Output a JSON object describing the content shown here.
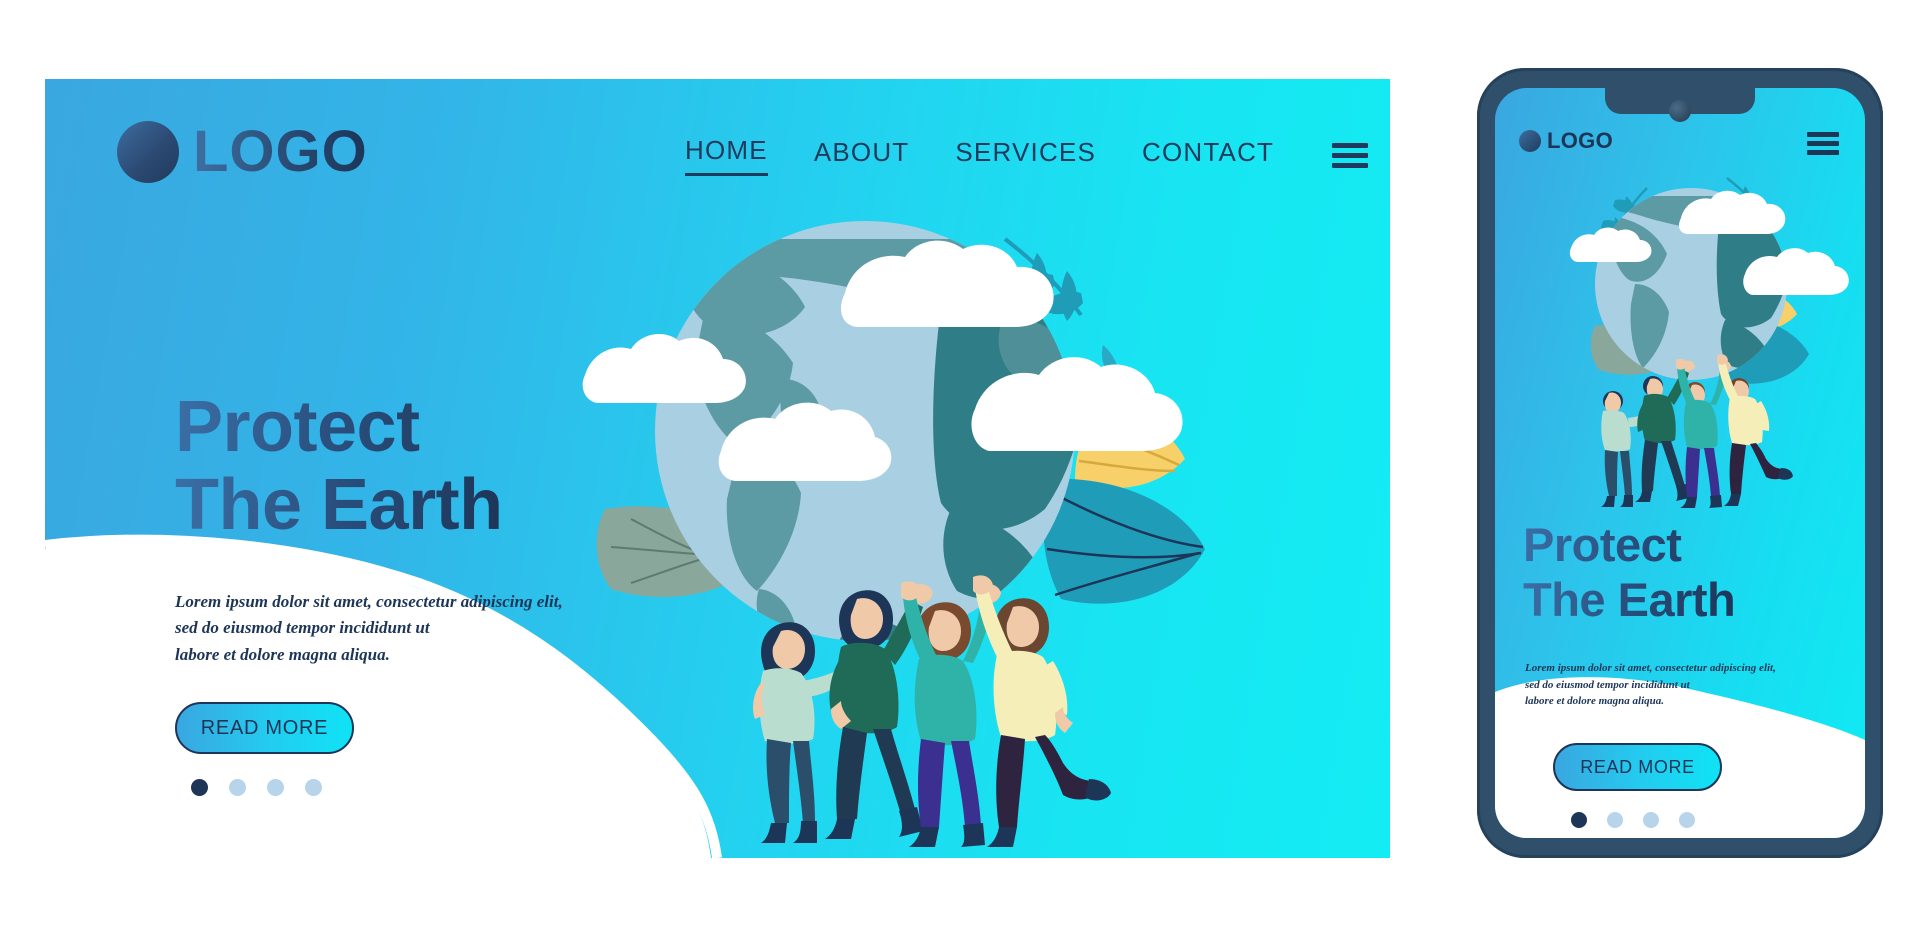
{
  "brand": {
    "logo_text": "LOGO",
    "accent_cyan": "#13ecf3",
    "accent_blue": "#3aa7e0",
    "navy": "#1d3557"
  },
  "desktop": {
    "nav": [
      {
        "label": "HOME",
        "active": true
      },
      {
        "label": "ABOUT",
        "active": false
      },
      {
        "label": "SERVICES",
        "active": false
      },
      {
        "label": "CONTACT",
        "active": false
      }
    ],
    "menu_icon": "hamburger-icon",
    "headline_line1": "Protect",
    "headline_line2": "The Earth",
    "paragraph": "Lorem ipsum dolor sit amet, consectetur adipiscing elit,\nsed do eiusmod tempor incididunt ut\nlabore et dolore magna aliqua.",
    "cta_label": "READ MORE",
    "carousel": {
      "count": 4,
      "active_index": 0
    }
  },
  "mobile": {
    "logo_text": "LOGO",
    "menu_icon": "hamburger-icon",
    "headline_line1": "Protect",
    "headline_line2": "The Earth",
    "paragraph": "Lorem ipsum dolor sit amet, consectetur adipiscing elit,\nsed do eiusmod tempor incididunt ut\nlabore et dolore magna aliqua.",
    "cta_label": "READ MORE",
    "carousel": {
      "count": 4,
      "active_index": 0
    }
  },
  "illustration": {
    "name": "earth-protection-illustration",
    "globe": {
      "ocean": "#a9cfe2",
      "land_light": "#5c9aa4",
      "land_dark": "#2f7d87"
    },
    "clouds": "#ffffff",
    "leaves": {
      "teal": "#1f9cb8",
      "orange": "#f5a623",
      "yellow": "#f7d06a",
      "sage": "#8aa79c"
    },
    "people": [
      {
        "name": "woman-waving",
        "top": "#b9ded0",
        "bottom": "#2b4f6b",
        "hair": "#1d3557"
      },
      {
        "name": "man-lifting-left",
        "top": "#1f6b58",
        "bottom": "#1f3a52",
        "hair": "#1d3557"
      },
      {
        "name": "person-lifting-center",
        "top": "#2fb3a8",
        "bottom": "#3b2f8f",
        "hair": "#7a4a2e"
      },
      {
        "name": "man-lifting-right",
        "top": "#f5eeb8",
        "bottom": "#2e2440",
        "hair": "#6b4630"
      }
    ]
  }
}
